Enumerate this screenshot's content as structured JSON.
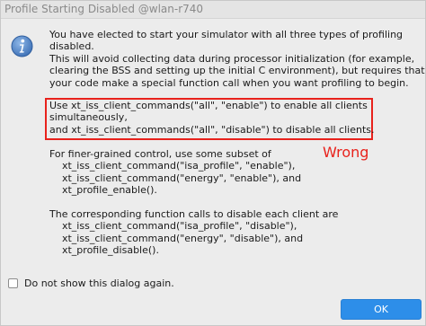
{
  "window": {
    "title": "Profile Starting Disabled @wlan-r740"
  },
  "message": {
    "intro_lines": [
      "You have elected to start your simulator with all three types of profiling",
      "disabled.",
      "This will avoid collecting data during processor initialization (for example,",
      "clearing the BSS and setting up the initial C environment), but requires that",
      "your code make a special function call when you want profiling to begin."
    ],
    "highlight_lines": [
      "Use xt_iss_client_commands(\"all\", \"enable\") to enable all clients",
      "simultaneously,",
      "and xt_iss_client_commands(\"all\", \"disable\") to disable all clients."
    ],
    "finegrain_lines": [
      "For finer-grained control, use some subset of",
      "    xt_iss_client_command(\"isa_profile\", \"enable\"),",
      "    xt_iss_client_command(\"energy\", \"enable\"), and",
      "    xt_profile_enable()."
    ],
    "disable_lines": [
      "The corresponding function calls to disable each client are",
      "    xt_iss_client_command(\"isa_profile\", \"disable\"),",
      "    xt_iss_client_command(\"energy\", \"disable\"), and",
      "    xt_profile_disable()."
    ]
  },
  "annotation": {
    "label": "Wrong",
    "color": "#e8221c"
  },
  "controls": {
    "dont_show_label": "Do not show this dialog again.",
    "dont_show_checked": false,
    "ok_label": "OK"
  },
  "icon": {
    "name": "info-icon"
  },
  "colors": {
    "accent": "#2d8ee9",
    "highlight": "#e8221c"
  }
}
